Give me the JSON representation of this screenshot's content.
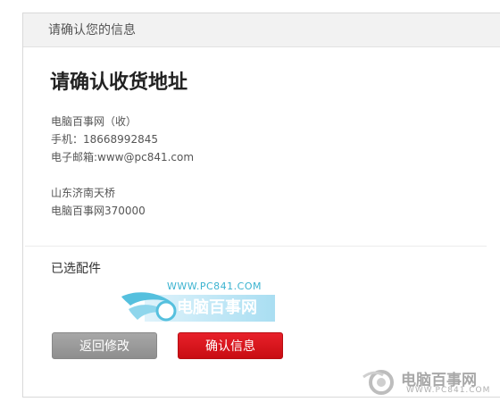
{
  "panel": {
    "header_title": "请确认您的信息"
  },
  "address": {
    "title": "请确认收货地址",
    "recipient": "电脑百事网（收）",
    "phone": "手机：18668992845",
    "email": "电子邮箱:www@pc841.com",
    "region": "山东济南天桥",
    "detail": "电脑百事网370000"
  },
  "parts": {
    "label": "已选配件"
  },
  "watermark": {
    "url": "WWW.PC841.COM",
    "name": "电脑百事网"
  },
  "buttons": {
    "back_label": "返回修改",
    "confirm_label": "确认信息"
  },
  "corner_logo": {
    "name": "电脑百事网",
    "url": "WWW.PC841.COM"
  },
  "colors": {
    "confirm": "#d9151c",
    "back": "#9b9b9b",
    "header_bg": "#f2f2f2",
    "watermark": "#3bb3d0"
  }
}
